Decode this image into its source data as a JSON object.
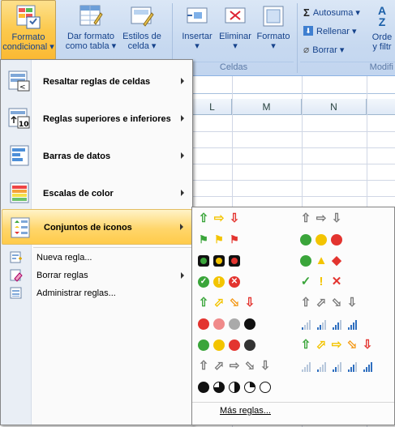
{
  "ribbon": {
    "buttons": [
      {
        "name": "conditional-format-button",
        "line1": "Formato",
        "line2": "condicional ▾"
      },
      {
        "name": "format-as-table-button",
        "line1": "Dar formato",
        "line2": "como tabla ▾"
      },
      {
        "name": "cell-styles-button",
        "line1": "Estilos de",
        "line2": "celda ▾"
      },
      {
        "name": "insert-button",
        "line1": "Insertar",
        "line2": "▾"
      },
      {
        "name": "delete-button",
        "line1": "Eliminar",
        "line2": "▾"
      },
      {
        "name": "format-button",
        "line1": "Formato",
        "line2": "▾"
      }
    ],
    "group_cells": "Celdas",
    "group_modify": "Modifi",
    "autosum": "Autosuma ▾",
    "fill": "Rellenar ▾",
    "clear": "Borrar ▾",
    "sort_line1": "Orde",
    "sort_line2": "y filtr"
  },
  "columns": [
    "L",
    "M",
    "N"
  ],
  "menu": {
    "items": [
      {
        "name": "highlight-rules",
        "label": "Resaltar reglas de celdas"
      },
      {
        "name": "top-bottom-rules",
        "label": "Reglas superiores e inferiores"
      },
      {
        "name": "data-bars",
        "label": "Barras de datos"
      },
      {
        "name": "color-scales",
        "label": "Escalas de color"
      },
      {
        "name": "icon-sets",
        "label": "Conjuntos de iconos"
      }
    ],
    "small_items": [
      {
        "name": "new-rule",
        "label": "Nueva regla..."
      },
      {
        "name": "clear-rules",
        "label": "Borrar reglas"
      },
      {
        "name": "manage-rules",
        "label": "Administrar reglas..."
      }
    ]
  },
  "submenu": {
    "more_rules": "Más reglas..."
  },
  "colors": {
    "green": "#3aa53a",
    "yellow": "#f3c400",
    "red": "#e3342f",
    "orange": "#f49a1a",
    "gray": "#7a7a7a",
    "accent": "#ffcb4a"
  }
}
